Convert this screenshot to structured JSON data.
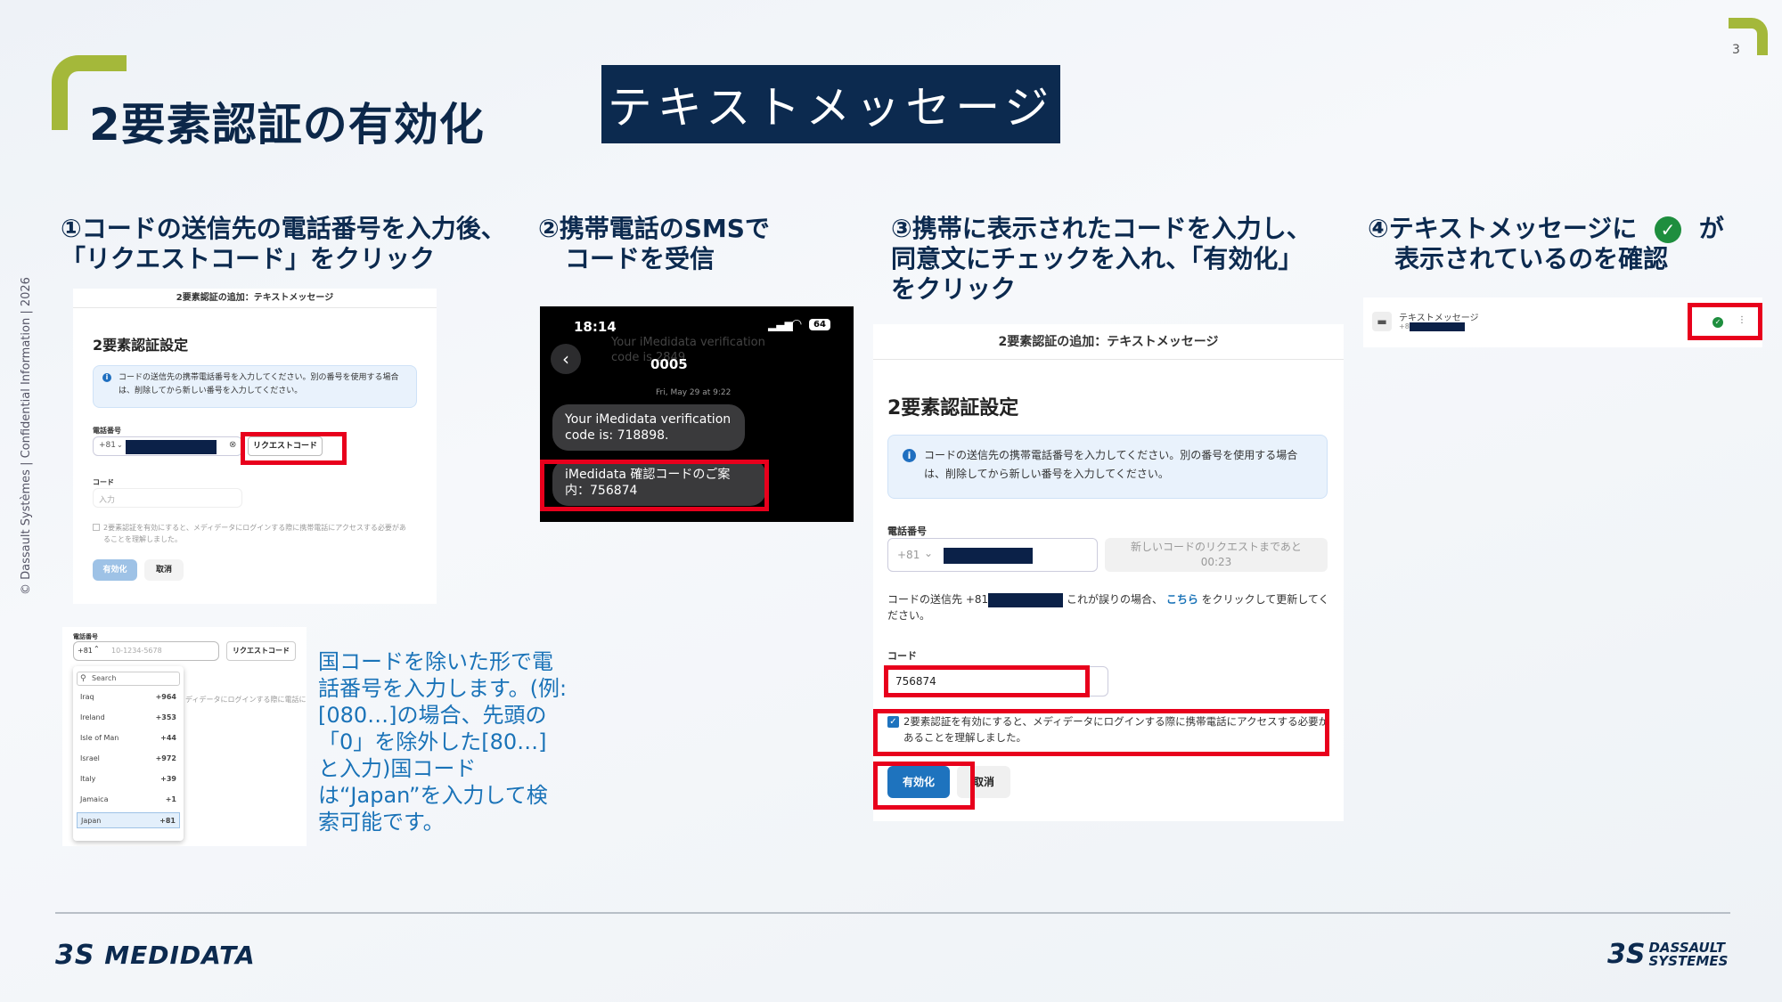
{
  "page": {
    "number": "3",
    "title": "2要素認証の有効化",
    "banner": "テキストメッセージ",
    "side_text": "© Dassault Systèmes | Confidential Information | 2026"
  },
  "steps": {
    "s1_line1": "①コードの送信先の電話番号を入力後、",
    "s1_line2": "「リクエストコード」をクリック",
    "s2_line1": "②携帯電話のSMSで",
    "s2_line2": "コードを受信",
    "s3_line1": "③携帯に表示されたコードを入力し、",
    "s3_line2": "同意文にチェックを入れ、「有効化」",
    "s3_line3": "をクリック",
    "s4_line1a": "④テキストメッセージに",
    "s4_line1b": "が",
    "s4_line2": "表示されているのを確認"
  },
  "panel1": {
    "header": "2要素認証の追加：テキストメッセージ",
    "heading": "2要素認証設定",
    "info": "コードの送信先の携帯電話番号を入力してください。別の番号を使用する場合は、削除してから新しい番号を入力してください。",
    "phone_label": "電話番号",
    "country_code": "+81",
    "request_button": "リクエストコード",
    "code_label": "コード",
    "code_placeholder": "入力",
    "consent": "2要素認証を有効にすると、メディデータにログインする際に携帯電話にアクセスする必要があることを理解しました。",
    "enable_button": "有効化",
    "cancel_button": "取消"
  },
  "phone_sms": {
    "time": "18:14",
    "battery": "64",
    "sender": "0005",
    "date": "Fri, May 29 at 9:22",
    "ghost": "Your iMedidata verification code is 2849",
    "msg1": "Your iMedidata verification code is: 718898.",
    "msg2": "iMedidata 確認コードのご案内：756874"
  },
  "dropdown": {
    "phone_label": "電話番号",
    "country_code": "+81",
    "placeholder": "10-1234-5678",
    "request_button": "リクエストコード",
    "search": "Search",
    "bg_text": "ディデータにログインする際に電話に",
    "items": [
      {
        "name": "Iraq",
        "code": "+964"
      },
      {
        "name": "Ireland",
        "code": "+353"
      },
      {
        "name": "Isle of Man",
        "code": "+44"
      },
      {
        "name": "Israel",
        "code": "+972"
      },
      {
        "name": "Italy",
        "code": "+39"
      },
      {
        "name": "Jamaica",
        "code": "+1"
      },
      {
        "name": "Japan",
        "code": "+81"
      }
    ]
  },
  "note": "国コードを除いた形で電話番号を入力します。(例: [080…]の場合、先頭の「0」を除外した[80…]と入力)国コードは“Japan”を入力して検索可能です。",
  "panel3": {
    "header": "2要素認証の追加：テキストメッセージ",
    "heading": "2要素認証設定",
    "info": "コードの送信先の携帯電話番号を入力してください。別の番号を使用する場合は、削除してから新しい番号を入力してください。",
    "phone_label": "電話番号",
    "country_code": "+81",
    "countdown_line1": "新しいコードのリクエストまであと",
    "countdown_line2": "00:23",
    "sent_prefix": "コードの送信先 +81",
    "sent_mid": "これが誤りの場合、",
    "sent_link": "こちら",
    "sent_suffix": "をクリックして更新してください。",
    "code_label": "コード",
    "code_value": "756874",
    "consent": "2要素認証を有効にすると、メディデータにログインする際に携帯電話にアクセスする必要があることを理解しました。",
    "enable_button": "有効化",
    "cancel_button": "取消"
  },
  "panel4": {
    "label": "テキストメッセージ",
    "country_code": "+81"
  },
  "footer": {
    "logo_left": "MEDIDATA",
    "logo_right_1": "DASSAULT",
    "logo_right_2": "SYSTEMES"
  },
  "colors": {
    "navy": "#0c2a4f",
    "accent_green": "#a4b83a",
    "highlight_red": "#e8001c",
    "link_blue": "#1a73b8",
    "success_green": "#1e8e3e"
  }
}
